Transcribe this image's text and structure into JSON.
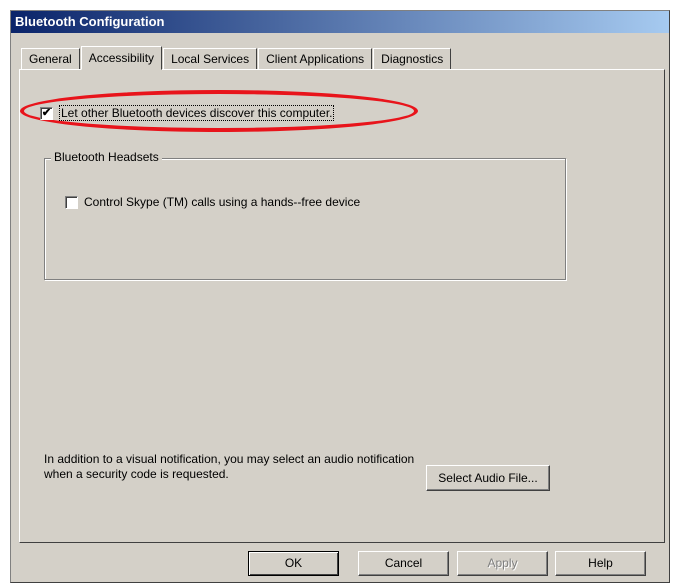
{
  "window": {
    "title": "Bluetooth Configuration"
  },
  "tabs": [
    {
      "label": "General",
      "active": false
    },
    {
      "label": "Accessibility",
      "active": true
    },
    {
      "label": "Local Services",
      "active": false
    },
    {
      "label": "Client Applications",
      "active": false
    },
    {
      "label": "Diagnostics",
      "active": false
    }
  ],
  "discover": {
    "label": "Let other Bluetooth devices discover this computer.",
    "checked": true,
    "check_glyph": "✔",
    "highlight_color": "#e8141b"
  },
  "headsets": {
    "group_title": "Bluetooth Headsets",
    "skype_label": "Control Skype (TM) calls using a hands--free device",
    "skype_checked": false
  },
  "notification": {
    "text": "In addition to a visual notification, you may select an audio notification when a security code is requested.",
    "select_button": "Select Audio File..."
  },
  "buttons": {
    "ok": "OK",
    "cancel": "Cancel",
    "apply": "Apply",
    "help": "Help"
  }
}
